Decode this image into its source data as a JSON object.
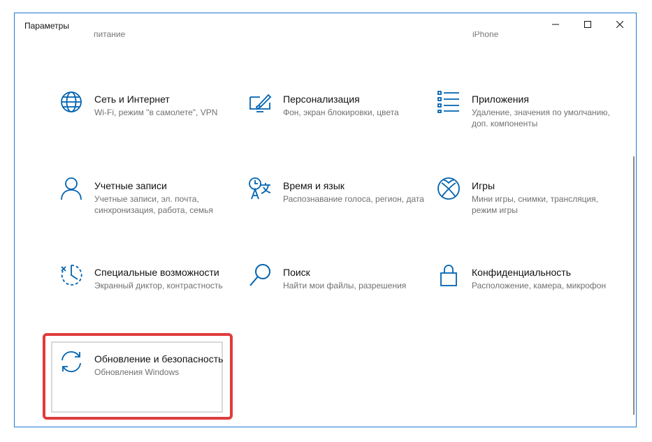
{
  "window": {
    "title": "Параметры"
  },
  "cutoff": {
    "left": "питание",
    "right": "iPhone"
  },
  "tiles": [
    {
      "name": "Сеть и Интернет",
      "desc": "Wi-Fi, режим \"в самолете\", VPN",
      "icon": "globe-icon"
    },
    {
      "name": "Персонализация",
      "desc": "Фон, экран блокировки, цвета",
      "icon": "personalization-icon"
    },
    {
      "name": "Приложения",
      "desc": "Удаление, значения по умолчанию, доп. компоненты",
      "icon": "apps-list-icon"
    },
    {
      "name": "Учетные записи",
      "desc": "Учетные записи, эл. почта, синхронизация, работа, семья",
      "icon": "person-icon"
    },
    {
      "name": "Время и язык",
      "desc": "Распознавание голоса, регион, дата",
      "icon": "time-language-icon"
    },
    {
      "name": "Игры",
      "desc": "Мини игры, снимки, трансляция, режим игры",
      "icon": "xbox-icon"
    },
    {
      "name": "Специальные возможности",
      "desc": "Экранный диктор, контрастность",
      "icon": "accessibility-icon"
    },
    {
      "name": "Поиск",
      "desc": "Найти мои файлы, разрешения",
      "icon": "search-icon"
    },
    {
      "name": "Конфиденциальность",
      "desc": "Расположение, камера, микрофон",
      "icon": "lock-icon"
    },
    {
      "name": "Обновление и безопасность",
      "desc": "Обновления Windows",
      "icon": "update-sync-icon"
    }
  ],
  "colors": {
    "accent": "#0063b1",
    "highlight": "#e03c3c"
  }
}
